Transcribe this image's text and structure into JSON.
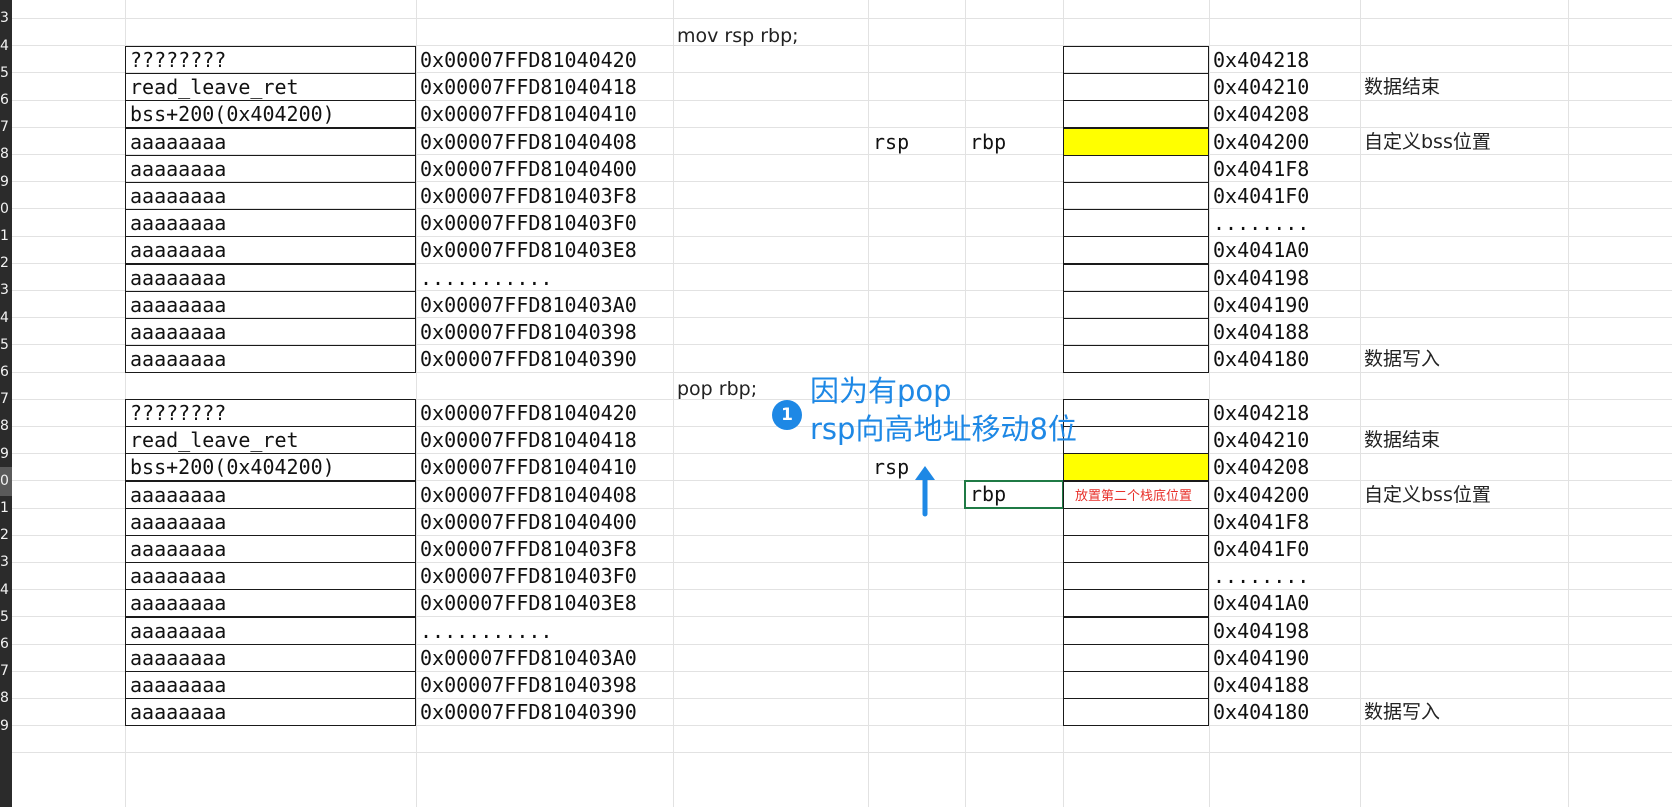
{
  "row_numbers": [
    "3",
    "4",
    "5",
    "6",
    "7",
    "8",
    "9",
    "0",
    "1",
    "2",
    "3",
    "4",
    "5",
    "6",
    "7",
    "8",
    "9",
    "0",
    "1",
    "2",
    "3",
    "4",
    "5",
    "6",
    "7",
    "8",
    "9"
  ],
  "selected_row_number": "0",
  "section1": {
    "caption": "mov rsp rbp;",
    "stack_values": [
      "????????",
      "read_leave_ret",
      "bss+200(0x404200)",
      "aaaaaaaa",
      "aaaaaaaa",
      "aaaaaaaa",
      "aaaaaaaa",
      "aaaaaaaa",
      "aaaaaaaa",
      "aaaaaaaa",
      "aaaaaaaa",
      "aaaaaaaa"
    ],
    "stack_addresses": [
      "0x00007FFD81040420",
      "0x00007FFD81040418",
      "0x00007FFD81040410",
      "0x00007FFD81040408",
      "0x00007FFD81040400",
      "0x00007FFD810403F8",
      "0x00007FFD810403F0",
      "0x00007FFD810403E8",
      "...........",
      "0x00007FFD810403A0",
      "0x00007FFD81040398",
      "0x00007FFD81040390"
    ],
    "rsp_label": "rsp",
    "rbp_label": "rbp",
    "bss_addresses": [
      "0x404218",
      "0x404210",
      "0x404208",
      "0x404200",
      "0x4041F8",
      "0x4041F0",
      "........",
      "0x4041A0",
      "0x404198",
      "0x404190",
      "0x404188",
      "0x404180"
    ],
    "bss_notes": [
      "",
      "数据结束",
      "",
      "自定义bss位置",
      "",
      "",
      "",
      "",
      "",
      "",
      "",
      "数据写入"
    ]
  },
  "section2": {
    "caption": "pop rbp;",
    "stack_values": [
      "????????",
      "read_leave_ret",
      "bss+200(0x404200)",
      "aaaaaaaa",
      "aaaaaaaa",
      "aaaaaaaa",
      "aaaaaaaa",
      "aaaaaaaa",
      "aaaaaaaa",
      "aaaaaaaa",
      "aaaaaaaa",
      "aaaaaaaa"
    ],
    "stack_addresses": [
      "0x00007FFD81040420",
      "0x00007FFD81040418",
      "0x00007FFD81040410",
      "0x00007FFD81040408",
      "0x00007FFD81040400",
      "0x00007FFD810403F8",
      "0x00007FFD810403F0",
      "0x00007FFD810403E8",
      "...........",
      "0x00007FFD810403A0",
      "0x00007FFD81040398",
      "0x00007FFD81040390"
    ],
    "rsp_label": "rsp",
    "rbp_label": "rbp",
    "second_stack_note": "放置第二个栈底位置",
    "bss_addresses": [
      "0x404218",
      "0x404210",
      "0x404208",
      "0x404200",
      "0x4041F8",
      "0x4041F0",
      "........",
      "0x4041A0",
      "0x404198",
      "0x404190",
      "0x404188",
      "0x404180"
    ],
    "bss_notes": [
      "",
      "数据结束",
      "",
      "自定义bss位置",
      "",
      "",
      "",
      "",
      "",
      "",
      "",
      "数据写入"
    ]
  },
  "annotation": {
    "badge": "1",
    "line1": "因为有pop",
    "line2": "rsp向高地址移动8位"
  },
  "colors": {
    "highlight": "#ffff00",
    "annotation": "#1e88e5",
    "note_red": "#e8302a",
    "selection": "#1f7a45"
  },
  "icons": [
    "up-arrow-icon"
  ]
}
